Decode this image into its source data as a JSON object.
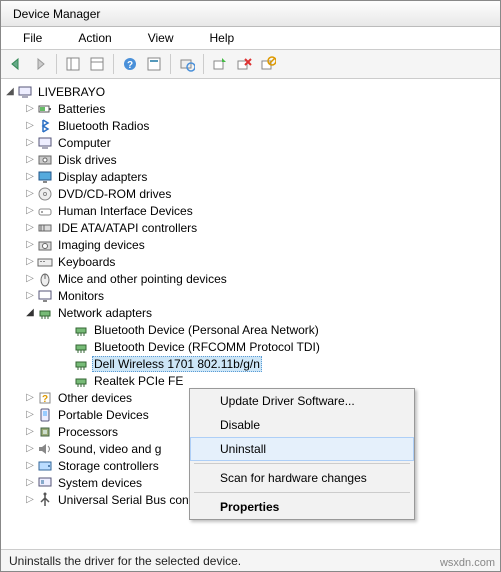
{
  "window": {
    "title": "Device Manager"
  },
  "menubar": {
    "file": "File",
    "action": "Action",
    "view": "View",
    "help": "Help"
  },
  "tree": {
    "root": "LIVEBRAYO",
    "categories": [
      {
        "label": "Batteries",
        "icon": "battery"
      },
      {
        "label": "Bluetooth Radios",
        "icon": "bt"
      },
      {
        "label": "Computer",
        "icon": "pc"
      },
      {
        "label": "Disk drives",
        "icon": "disk"
      },
      {
        "label": "Display adapters",
        "icon": "display"
      },
      {
        "label": "DVD/CD-ROM drives",
        "icon": "cd"
      },
      {
        "label": "Human Interface Devices",
        "icon": "hid"
      },
      {
        "label": "IDE ATA/ATAPI controllers",
        "icon": "ide"
      },
      {
        "label": "Imaging devices",
        "icon": "cam"
      },
      {
        "label": "Keyboards",
        "icon": "kb"
      },
      {
        "label": "Mice and other pointing devices",
        "icon": "mouse"
      },
      {
        "label": "Monitors",
        "icon": "mon"
      },
      {
        "label": "Network adapters",
        "icon": "net",
        "expanded": true,
        "children": [
          {
            "label": "Bluetooth Device (Personal Area Network)"
          },
          {
            "label": "Bluetooth Device (RFCOMM Protocol TDI)"
          },
          {
            "label": "Dell Wireless 1701 802.11b/g/n",
            "selected": true
          },
          {
            "label": "Realtek PCIe FE "
          }
        ]
      },
      {
        "label": "Other devices",
        "icon": "other"
      },
      {
        "label": "Portable Devices",
        "icon": "port"
      },
      {
        "label": "Processors",
        "icon": "cpu"
      },
      {
        "label": "Sound, video and g",
        "icon": "sound"
      },
      {
        "label": "Storage controllers",
        "icon": "storage"
      },
      {
        "label": "System devices",
        "icon": "sys"
      },
      {
        "label": "Universal Serial Bus controllers",
        "icon": "usb"
      }
    ]
  },
  "ctxmenu": {
    "items": [
      {
        "label": "Update Driver Software..."
      },
      {
        "label": "Disable"
      },
      {
        "label": "Uninstall",
        "hover": true
      },
      {
        "sep": true
      },
      {
        "label": "Scan for hardware changes"
      },
      {
        "sep": true
      },
      {
        "label": "Properties",
        "bold": true
      }
    ]
  },
  "statusbar": {
    "text": "Uninstalls the driver for the selected device."
  },
  "brand": "wsxdn.com"
}
